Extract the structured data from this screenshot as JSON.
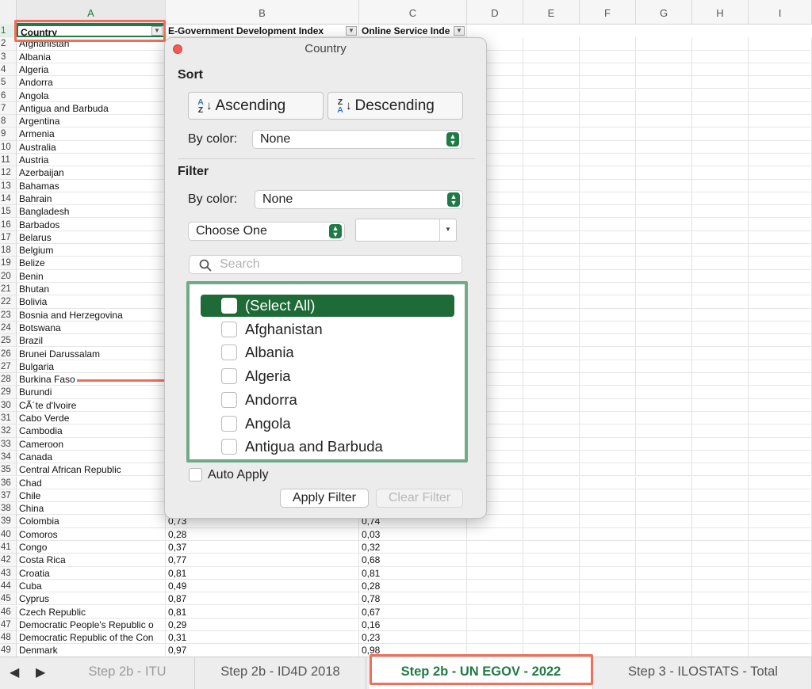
{
  "columns": [
    "A",
    "B",
    "C",
    "D",
    "E",
    "F",
    "G",
    "H",
    "I"
  ],
  "headers": {
    "a": "Country",
    "b": "E-Government Development Index",
    "c": "Online Service Inde"
  },
  "rows": [
    {
      "n": "2",
      "a": "Afghanistan",
      "b": "",
      "c": ""
    },
    {
      "n": "3",
      "a": "Albania",
      "b": "",
      "c": ""
    },
    {
      "n": "4",
      "a": "Algeria",
      "b": "",
      "c": ""
    },
    {
      "n": "5",
      "a": "Andorra",
      "b": "",
      "c": ""
    },
    {
      "n": "6",
      "a": "Angola",
      "b": "",
      "c": ""
    },
    {
      "n": "7",
      "a": "Antigua and Barbuda",
      "b": "",
      "c": ""
    },
    {
      "n": "8",
      "a": "Argentina",
      "b": "",
      "c": ""
    },
    {
      "n": "9",
      "a": "Armenia",
      "b": "",
      "c": ""
    },
    {
      "n": "10",
      "a": "Australia",
      "b": "",
      "c": ""
    },
    {
      "n": "11",
      "a": "Austria",
      "b": "",
      "c": ""
    },
    {
      "n": "12",
      "a": "Azerbaijan",
      "b": "",
      "c": ""
    },
    {
      "n": "13",
      "a": "Bahamas",
      "b": "",
      "c": ""
    },
    {
      "n": "14",
      "a": "Bahrain",
      "b": "",
      "c": ""
    },
    {
      "n": "15",
      "a": "Bangladesh",
      "b": "",
      "c": ""
    },
    {
      "n": "16",
      "a": "Barbados",
      "b": "",
      "c": ""
    },
    {
      "n": "17",
      "a": "Belarus",
      "b": "",
      "c": ""
    },
    {
      "n": "18",
      "a": "Belgium",
      "b": "",
      "c": ""
    },
    {
      "n": "19",
      "a": "Belize",
      "b": "",
      "c": ""
    },
    {
      "n": "20",
      "a": "Benin",
      "b": "",
      "c": ""
    },
    {
      "n": "21",
      "a": "Bhutan",
      "b": "",
      "c": ""
    },
    {
      "n": "22",
      "a": "Bolivia",
      "b": "",
      "c": ""
    },
    {
      "n": "23",
      "a": "Bosnia and Herzegovina",
      "b": "",
      "c": ""
    },
    {
      "n": "24",
      "a": "Botswana",
      "b": "",
      "c": ""
    },
    {
      "n": "25",
      "a": "Brazil",
      "b": "",
      "c": ""
    },
    {
      "n": "26",
      "a": "Brunei Darussalam",
      "b": "",
      "c": ""
    },
    {
      "n": "27",
      "a": "Bulgaria",
      "b": "",
      "c": ""
    },
    {
      "n": "28",
      "a": "Burkina Faso",
      "b": "",
      "c": ""
    },
    {
      "n": "29",
      "a": "Burundi",
      "b": "",
      "c": ""
    },
    {
      "n": "30",
      "a": "CÃ´te d'Ivoire",
      "b": "",
      "c": ""
    },
    {
      "n": "31",
      "a": "Cabo Verde",
      "b": "",
      "c": ""
    },
    {
      "n": "32",
      "a": "Cambodia",
      "b": "",
      "c": ""
    },
    {
      "n": "33",
      "a": "Cameroon",
      "b": "",
      "c": ""
    },
    {
      "n": "34",
      "a": "Canada",
      "b": "",
      "c": ""
    },
    {
      "n": "35",
      "a": "Central African Republic",
      "b": "",
      "c": ""
    },
    {
      "n": "36",
      "a": "Chad",
      "b": "",
      "c": ""
    },
    {
      "n": "37",
      "a": "Chile",
      "b": "",
      "c": ""
    },
    {
      "n": "38",
      "a": "China",
      "b": "",
      "c": ""
    },
    {
      "n": "39",
      "a": "Colombia",
      "b": "0,73",
      "c": "0,74"
    },
    {
      "n": "40",
      "a": "Comoros",
      "b": "0,28",
      "c": "0,03"
    },
    {
      "n": "41",
      "a": "Congo",
      "b": "0,37",
      "c": "0,32"
    },
    {
      "n": "42",
      "a": "Costa Rica",
      "b": "0,77",
      "c": "0,68"
    },
    {
      "n": "43",
      "a": "Croatia",
      "b": "0,81",
      "c": "0,81"
    },
    {
      "n": "44",
      "a": "Cuba",
      "b": "0,49",
      "c": "0,28"
    },
    {
      "n": "45",
      "a": "Cyprus",
      "b": "0,87",
      "c": "0,78"
    },
    {
      "n": "46",
      "a": "Czech Republic",
      "b": "0,81",
      "c": "0,67"
    },
    {
      "n": "47",
      "a": "Democratic People's Republic o",
      "b": "0,29",
      "c": "0,16"
    },
    {
      "n": "48",
      "a": "Democratic Republic of the Con",
      "b": "0,31",
      "c": "0,23"
    },
    {
      "n": "49",
      "a": "Denmark",
      "b": "0,97",
      "c": "0,98"
    }
  ],
  "filter_popup": {
    "title": "Country",
    "sort_title": "Sort",
    "ascending_label": "Ascending",
    "descending_label": "Descending",
    "az_top": "A",
    "az_bottom": "Z",
    "za_top": "Z",
    "za_bottom": "A",
    "sort_by_color_label": "By color:",
    "sort_by_color_value": "None",
    "filter_title": "Filter",
    "filter_by_color_label": "By color:",
    "filter_by_color_value": "None",
    "criteria_value": "Choose One",
    "criteria_input_value": "",
    "search_placeholder": "Search",
    "list_items": [
      {
        "label": "(Select All)",
        "checked": false,
        "highlighted": true
      },
      {
        "label": "Afghanistan",
        "checked": false
      },
      {
        "label": "Albania",
        "checked": false
      },
      {
        "label": "Algeria",
        "checked": false
      },
      {
        "label": "Andorra",
        "checked": false
      },
      {
        "label": "Angola",
        "checked": false
      },
      {
        "label": "Antigua and Barbuda",
        "checked": false
      }
    ],
    "auto_apply_label": "Auto Apply",
    "auto_apply_checked": false,
    "apply_label": "Apply Filter",
    "clear_label": "Clear Filter"
  },
  "sheet_tabs": {
    "prev_icon": "triangle-left-icon",
    "next_icon": "triangle-right-icon",
    "tabs": [
      {
        "label": "Step 2b - ITU",
        "active": false
      },
      {
        "label": "Step 2b - ID4D 2018",
        "active": false
      },
      {
        "label": "Step 2b - UN EGOV - 2022",
        "active": true
      },
      {
        "label": "Step 3 - ILOSTATS - Total",
        "active": false
      }
    ]
  },
  "colors": {
    "accent_green": "#1e6b37",
    "annotation_red": "#ef6f5a",
    "list_border": "#70ab88"
  }
}
